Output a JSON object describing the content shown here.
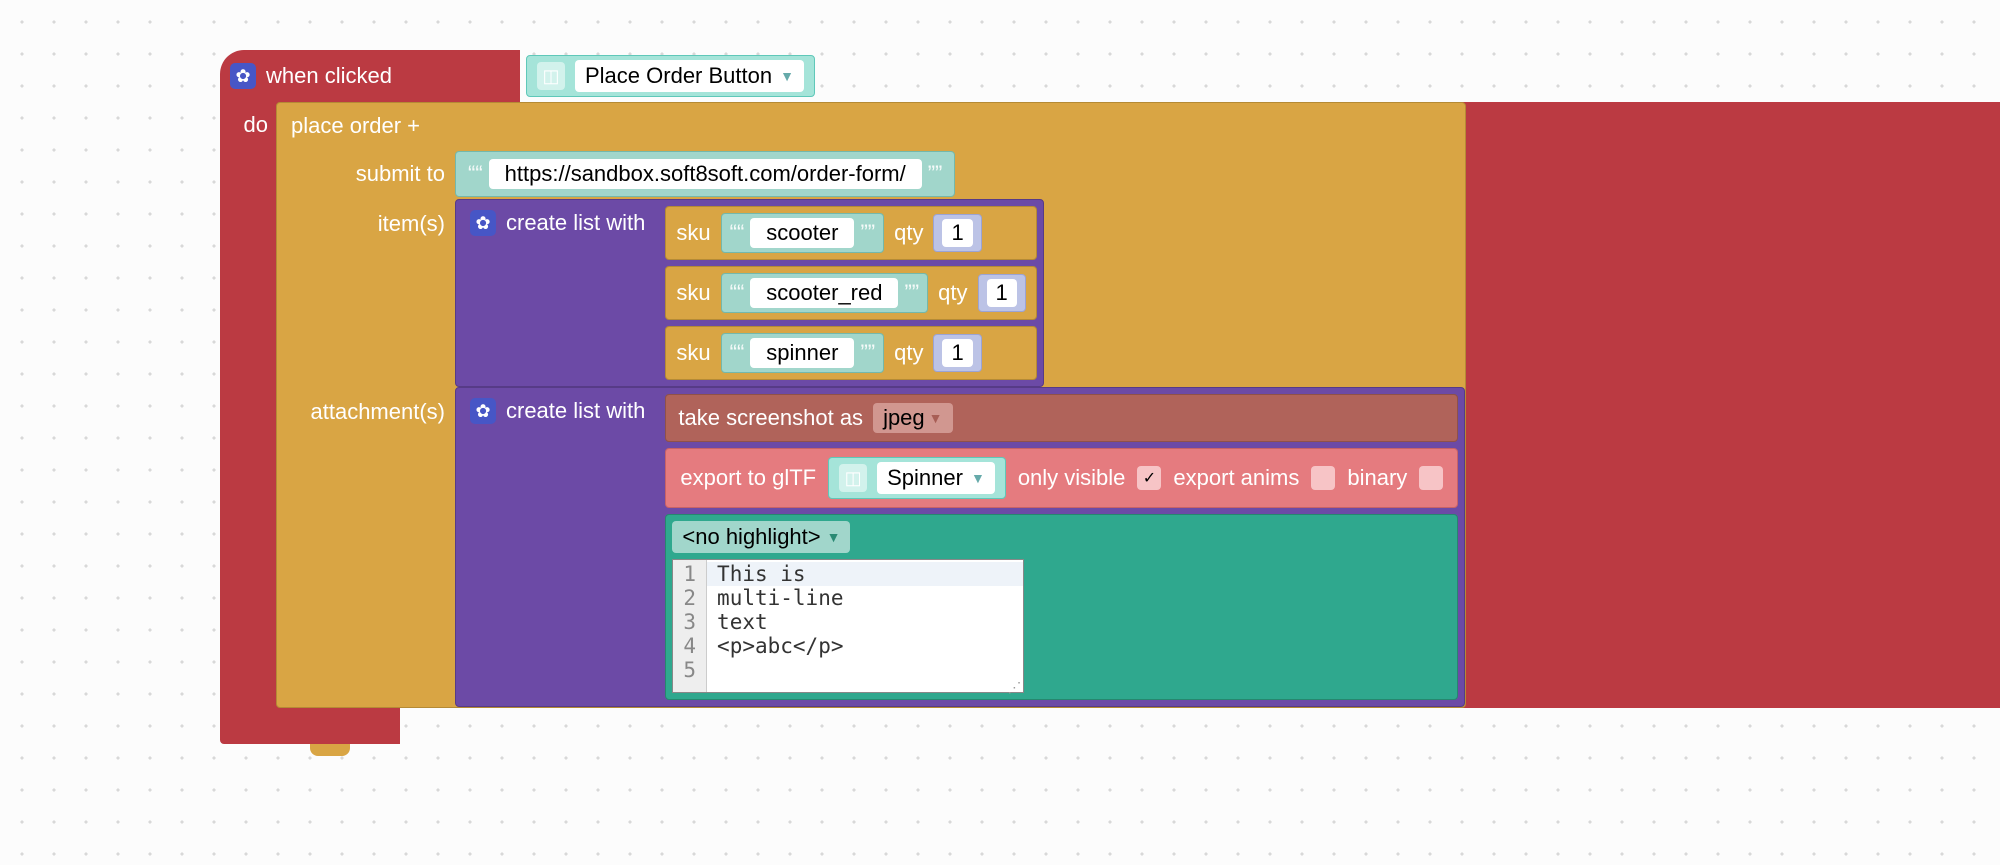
{
  "event": {
    "label": "when clicked",
    "object": "Place Order Button",
    "do_label": "do"
  },
  "order": {
    "title": "place order +",
    "submit_label": "submit to",
    "submit_url": "https://sandbox.soft8soft.com/order-form/",
    "items_label": "item(s)",
    "attachments_label": "attachment(s)"
  },
  "list": {
    "create_label": "create list with"
  },
  "items": [
    {
      "sku_label": "sku",
      "sku": "scooter",
      "qty_label": "qty",
      "qty": "1"
    },
    {
      "sku_label": "sku",
      "sku": "scooter_red",
      "qty_label": "qty",
      "qty": "1"
    },
    {
      "sku_label": "sku",
      "sku": "spinner",
      "qty_label": "qty",
      "qty": "1"
    }
  ],
  "screenshot": {
    "label": "take screenshot as",
    "format": "jpeg"
  },
  "gltf": {
    "label": "export to glTF",
    "object": "Spinner",
    "only_visible_label": "only visible",
    "only_visible": true,
    "export_anims_label": "export anims",
    "export_anims": false,
    "binary_label": "binary",
    "binary": false
  },
  "code": {
    "highlight": "<no highlight>",
    "lines": [
      "This is",
      "multi-line",
      "text",
      "<p>abc</p>",
      ""
    ]
  }
}
